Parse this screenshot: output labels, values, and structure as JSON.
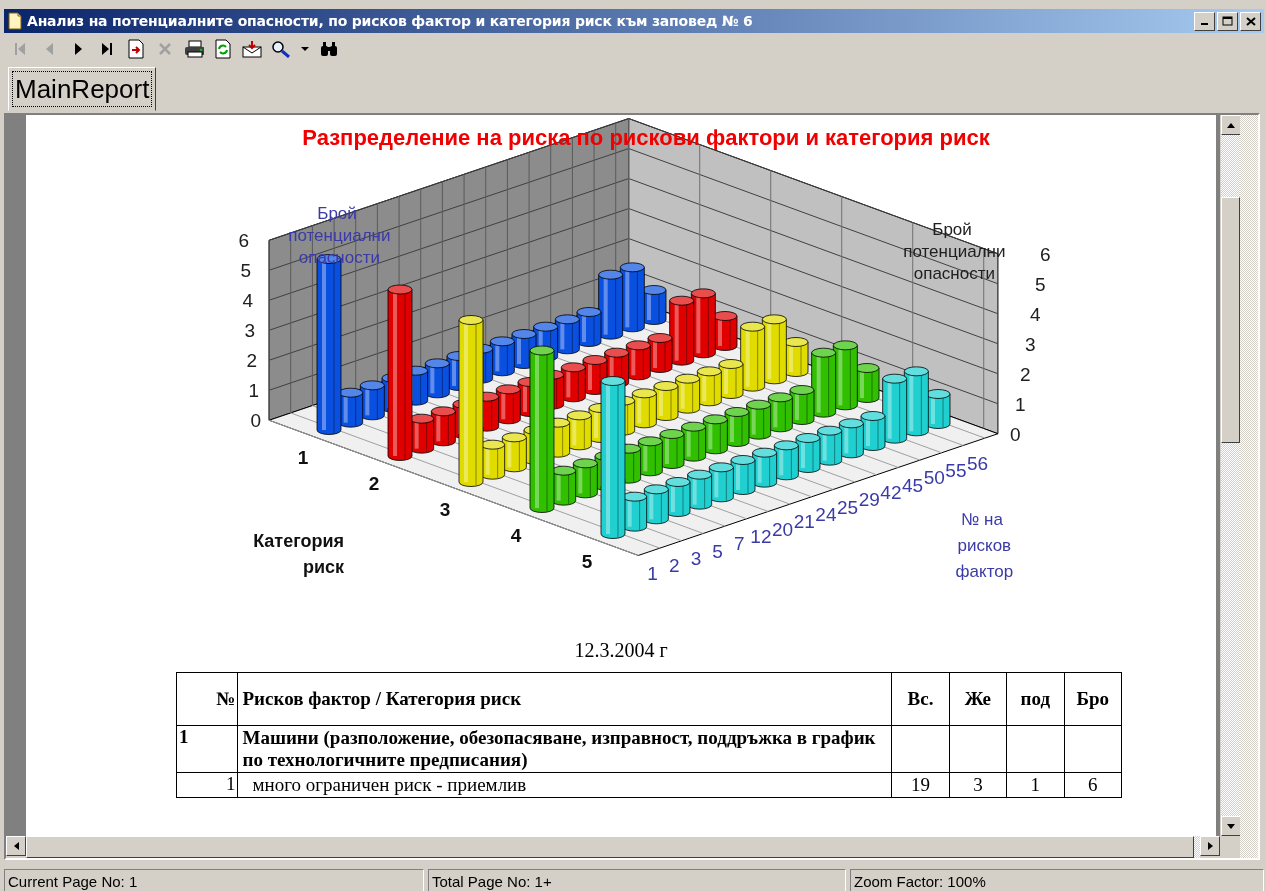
{
  "window": {
    "title": "Анализ на потенциалните опасности, по рисков фактор и категория риск към заповед № 6"
  },
  "toolbar": [
    {
      "kind": "first",
      "disabled": true
    },
    {
      "kind": "prev",
      "disabled": true
    },
    {
      "kind": "next",
      "disabled": false
    },
    {
      "kind": "last",
      "disabled": false
    },
    {
      "kind": "export",
      "disabled": false
    },
    {
      "kind": "cancel",
      "disabled": true
    },
    {
      "kind": "print",
      "disabled": false
    },
    {
      "kind": "refresh",
      "disabled": false
    },
    {
      "kind": "mail",
      "disabled": false
    },
    {
      "kind": "zoom",
      "disabled": false
    },
    {
      "kind": "dropdown",
      "disabled": false
    },
    {
      "kind": "find",
      "disabled": false
    }
  ],
  "tabs": [
    {
      "label": "MainReport",
      "selected": true
    }
  ],
  "report": {
    "chart": {
      "title": "Разпределение на риска по рискови фактори и категория риск",
      "left_axis_title": "Брой потенциални опасности",
      "right_axis_title": "Брой потенциални опасности",
      "depth_axis_title": "Категория риск",
      "front_axis_title": "№ на рисков фактор",
      "left_ticks": [
        "6",
        "5",
        "4",
        "3",
        "2",
        "1",
        "0"
      ],
      "right_ticks": [
        "6",
        "5",
        "4",
        "3",
        "2",
        "1",
        "0"
      ],
      "front_labels": [
        "1",
        "2",
        "3",
        "5",
        "7",
        "12",
        "20",
        "21",
        "24",
        "25",
        "29",
        "42",
        "45",
        "50",
        "55",
        "56"
      ],
      "series": [
        {
          "name": "1",
          "color": "#0a50e0"
        },
        {
          "name": "2",
          "color": "#e00000"
        },
        {
          "name": "3",
          "color": "#e0dc00"
        },
        {
          "name": "4",
          "color": "#30c000"
        },
        {
          "name": "5",
          "color": "#20d0d0"
        }
      ]
    },
    "date": "12.3.2004 г",
    "table": {
      "columns": [
        "№",
        "Рисков фактор  /  Категория риск",
        "Вс.",
        "Же",
        "под",
        "Бро"
      ],
      "rows": [
        {
          "kind": "group",
          "number": "1",
          "text": "Машини (разположение, обезопасяване, изправност, поддръжка в график по технологичните предписания)"
        },
        {
          "kind": "item",
          "number": "1",
          "text": "много ограничен риск - приемлив",
          "values": [
            "19",
            "3",
            "1",
            "6"
          ]
        }
      ]
    }
  },
  "status_bar": [
    "Current Page No: 1",
    "Total Page No: 1+",
    "Zoom Factor: 100%"
  ]
}
